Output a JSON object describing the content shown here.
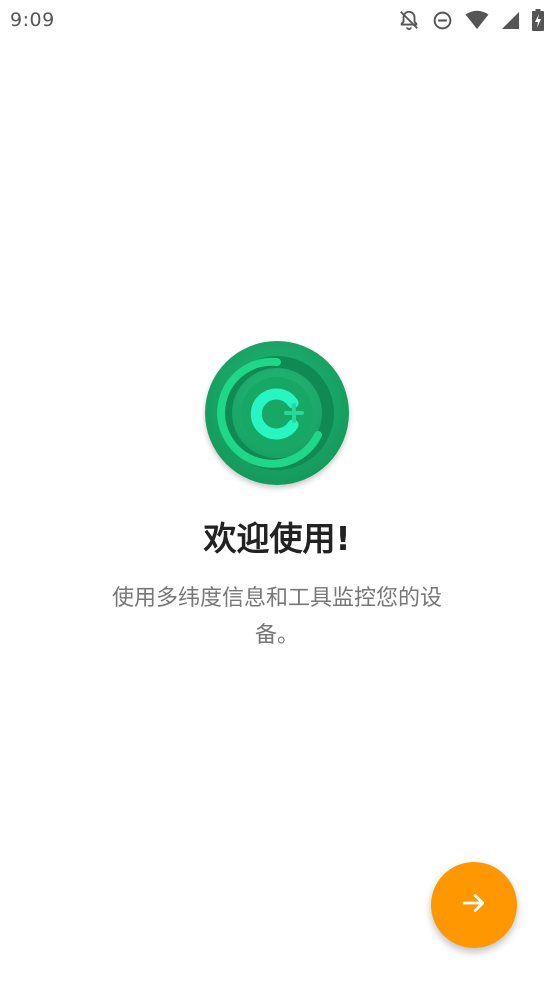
{
  "status_bar": {
    "time": "9:09",
    "icons": [
      "notifications-off-icon",
      "do-not-disturb-icon",
      "wifi-icon",
      "cell-signal-icon",
      "battery-charging-icon"
    ]
  },
  "welcome": {
    "logo_icon": "app-logo-icon",
    "title": "欢迎使用!",
    "description": "使用多纬度信息和工具监控您的设备。"
  },
  "next_button": {
    "icon": "arrow-right-icon",
    "color": "#ff9800"
  },
  "colors": {
    "accent": "#ff9800",
    "logo_green": "#1faa6b"
  }
}
